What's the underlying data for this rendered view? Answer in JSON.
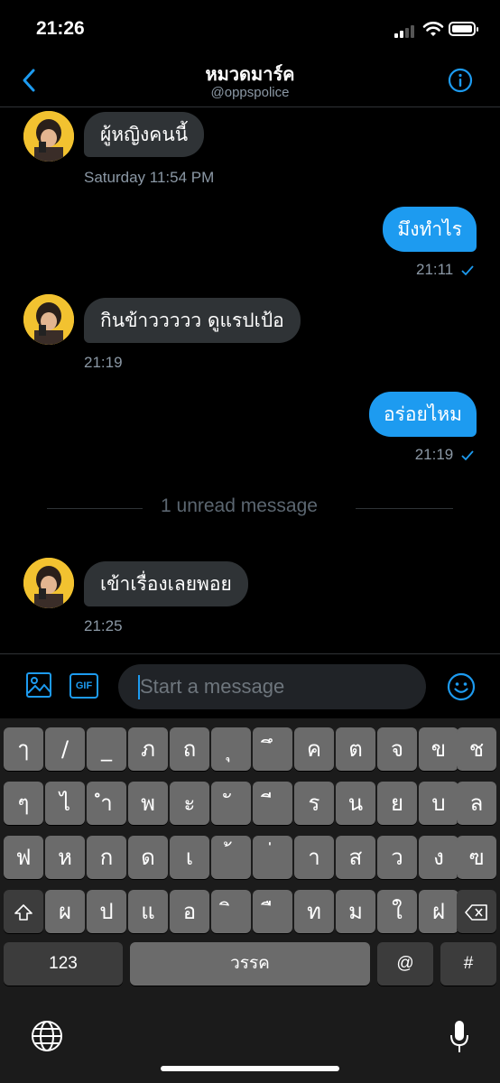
{
  "status_bar": {
    "time": "21:26"
  },
  "header": {
    "title": "หมวดมาร์ค",
    "handle": "@oppspolice"
  },
  "messages": [
    {
      "side": "in",
      "text": "ผู้หญิงคนนี้",
      "meta": "Saturday 11:54 PM"
    },
    {
      "side": "out",
      "text": "มึงทำไร",
      "meta": "21:11"
    },
    {
      "side": "in",
      "text": "กินข้าววววว ดูแรปเป้อ",
      "meta": "21:19"
    },
    {
      "side": "out",
      "text": "อร่อยไหม",
      "meta": "21:19"
    },
    {
      "side": "in",
      "text": "เข้าเรื่องเลยพอย",
      "meta": "21:25"
    }
  ],
  "unread_divider": "1 unread message",
  "compose": {
    "gif_label": "GIF",
    "placeholder": "Start a message"
  },
  "keyboard": {
    "row1": [
      "ๅ",
      "/",
      "_",
      "ภ",
      "ถ",
      "ุ",
      "ึ",
      "ค",
      "ต",
      "จ",
      "ข",
      "ช"
    ],
    "row2": [
      "ๆ",
      "ไ",
      "ำ",
      "พ",
      "ะ",
      "ั",
      "ี",
      "ร",
      "น",
      "ย",
      "บ",
      "ล"
    ],
    "row3": [
      "ฟ",
      "ห",
      "ก",
      "ด",
      "เ",
      "้",
      "่",
      "า",
      "ส",
      "ว",
      "ง",
      "ฃ"
    ],
    "row4": [
      "ผ",
      "ป",
      "แ",
      "อ",
      "ิ",
      "ื",
      "ท",
      "ม",
      "ใ",
      "ฝ"
    ],
    "numbers_label": "123",
    "space_label": "วรรค",
    "at_label": "@",
    "hash_label": "#"
  },
  "colors": {
    "accent": "#1d9bf0",
    "bubble_in": "#2f3336",
    "background": "#000000"
  }
}
